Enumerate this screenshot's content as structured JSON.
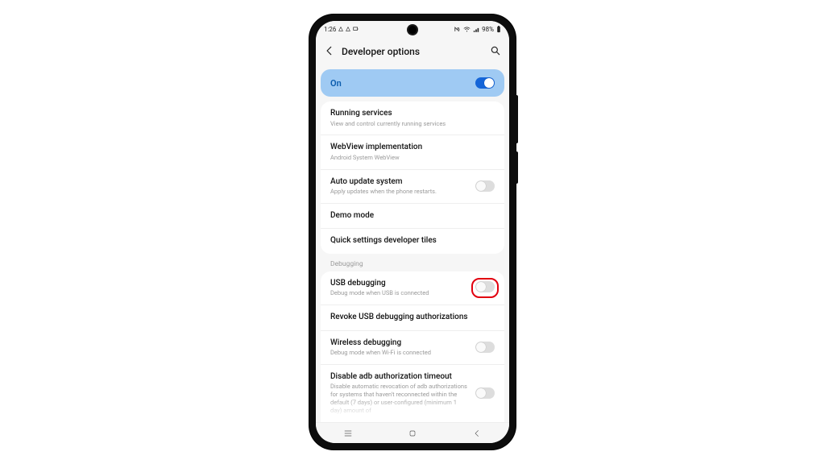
{
  "status": {
    "time": "1:26",
    "battery": "98%"
  },
  "header": {
    "title": "Developer options"
  },
  "banner": {
    "label": "On",
    "enabled": true
  },
  "sections": [
    {
      "rows": [
        {
          "title": "Running services",
          "sub": "View and control currently running services"
        },
        {
          "title": "WebView implementation",
          "sub": "Android System WebView"
        },
        {
          "title": "Auto update system",
          "sub": "Apply updates when the phone restarts.",
          "toggle": false
        },
        {
          "title": "Demo mode"
        },
        {
          "title": "Quick settings developer tiles"
        }
      ]
    },
    {
      "label": "Debugging",
      "rows": [
        {
          "title": "USB debugging",
          "sub": "Debug mode when USB is connected",
          "toggle": false,
          "highlight": true
        },
        {
          "title": "Revoke USB debugging authorizations"
        },
        {
          "title": "Wireless debugging",
          "sub": "Debug mode when Wi-Fi is connected",
          "toggle": false
        },
        {
          "title": "Disable adb authorization timeout",
          "sub": "Disable automatic revocation of adb authorizations for systems that haven't reconnected within the default (7 days) or user-configured (minimum 1 day) amount of",
          "toggle": false
        }
      ]
    }
  ]
}
